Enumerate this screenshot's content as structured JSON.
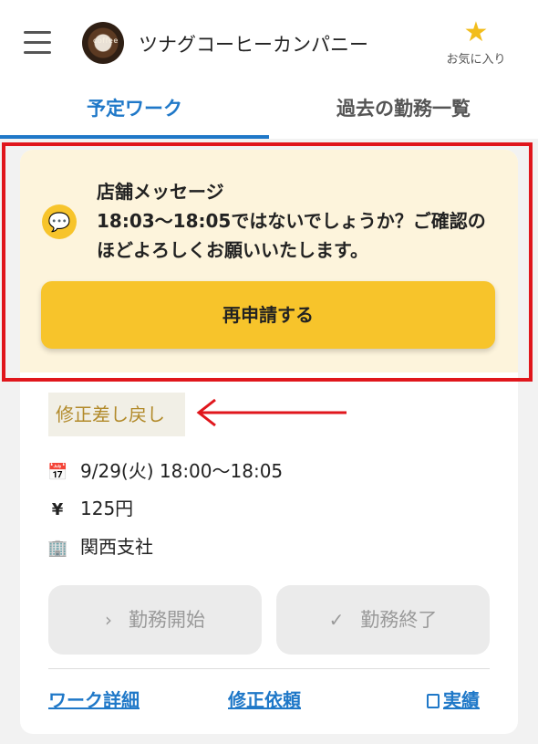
{
  "header": {
    "app_title": "ツナグコーヒーカンパニー",
    "logo_text": "coffee",
    "favorites_label": "お気に入り"
  },
  "tabs": [
    {
      "label": "予定ワーク",
      "active": true
    },
    {
      "label": "過去の勤務一覧",
      "active": false
    }
  ],
  "message": {
    "title": "店舗メッセージ",
    "text": "18:03〜18:05ではないでしょうか？ご確認のほどよろしくお願いいたします。",
    "reapply_label": "再申請する"
  },
  "status": {
    "label": "修正差し戻し"
  },
  "details": {
    "date": "9/29(火) 18:00〜18:05",
    "pay": "125円",
    "place": "関西支社"
  },
  "actions": {
    "start_label": "勤務開始",
    "end_label": "勤務終了"
  },
  "links": {
    "detail": "ワーク詳細",
    "request": "修正依頼",
    "record": "実績"
  },
  "colors": {
    "accent": "#1f78c8",
    "primary_button": "#f7c42b",
    "message_bg": "#fdf4dc",
    "annotation": "#e0161c"
  }
}
